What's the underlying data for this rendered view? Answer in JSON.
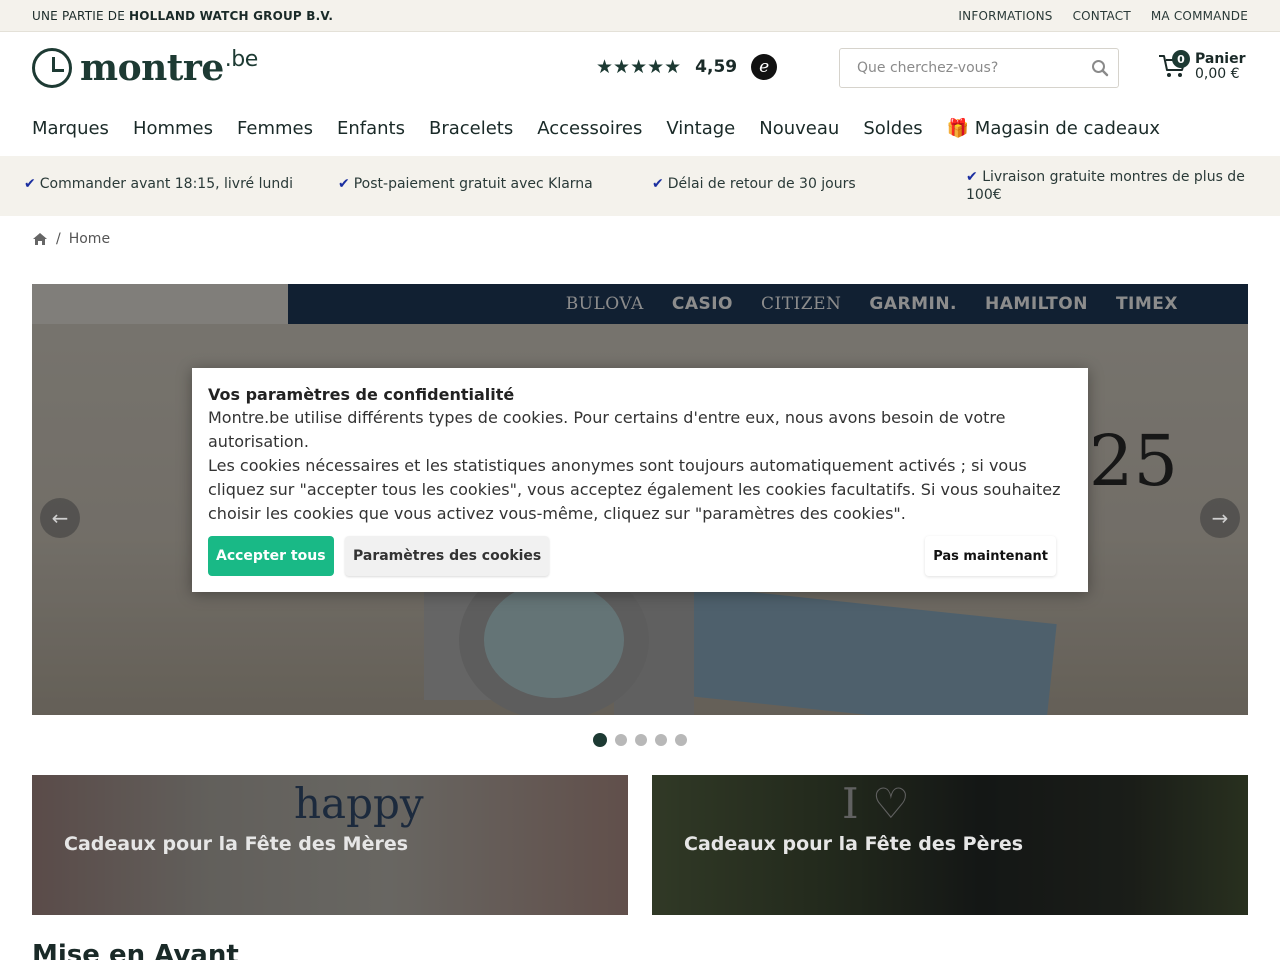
{
  "topbar": {
    "prefix": "UNE PARTIE DE ",
    "company": "HOLLAND WATCH GROUP B.V.",
    "links": [
      "INFORMATIONS",
      "CONTACT",
      "MA COMMANDE"
    ]
  },
  "header": {
    "logo_text": "montre",
    "logo_suffix": ".be",
    "rating": {
      "stars": "★★★★★",
      "value": "4,59",
      "badge": "e"
    },
    "search": {
      "placeholder": "Que cherchez-vous?",
      "value": ""
    },
    "cart": {
      "count": "0",
      "label": "Panier",
      "total": "0,00 €"
    }
  },
  "nav": [
    "Marques",
    "Hommes",
    "Femmes",
    "Enfants",
    "Bracelets",
    "Accessoires",
    "Vintage",
    "Nouveau",
    "Soldes",
    "🎁 Magasin de cadeaux"
  ],
  "usp": [
    "Commander avant 18:15, livré lundi",
    "Post-paiement gratuit avec Klarna",
    "Délai de retour de 30 jours",
    "Livraison gratuite montres de plus de 100€"
  ],
  "breadcrumb": {
    "separator": "/",
    "current": "Home"
  },
  "hero": {
    "brands": [
      "BULOVA",
      "CASIO",
      "CITIZEN",
      "GARMIN.",
      "HAMILTON",
      "TIMEX"
    ],
    "year_text": "25",
    "prev_arrow": "←",
    "next_arrow": "→",
    "slides": 5,
    "active_slide": 1
  },
  "tiles": [
    {
      "label": "Cadeaux pour la Fête des Mères",
      "deco": "happy"
    },
    {
      "label": "Cadeaux pour la Fête des Pères",
      "deco": "I ♡"
    }
  ],
  "section_title": "Mise en Avant",
  "cookie": {
    "title": "Vos paramètres de confidentialité",
    "paragraph1": "Montre.be utilise différents types de cookies. Pour certains d'entre eux, nous avons besoin de votre autorisation.",
    "paragraph2": "Les cookies nécessaires et les statistiques anonymes sont toujours automatiquement activés ; si vous cliquez sur \"accepter tous les cookies\", vous acceptez également les cookies facultatifs. Si vous souhaitez choisir les cookies que vous activez vous-même, cliquez sur \"paramètres des cookies\".",
    "accept_label": "Accepter tous",
    "settings_label": "Paramètres des cookies",
    "later_label": "Pas maintenant"
  },
  "colors": {
    "brand_dark": "#1d3a33",
    "accept_green": "#19b986",
    "usp_check": "#1b2fa0",
    "strip_bg": "#f4f2ec"
  }
}
